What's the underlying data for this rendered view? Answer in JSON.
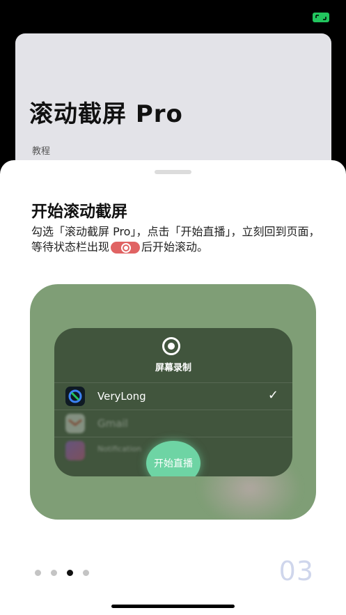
{
  "status": {
    "icon": "fullscreen-icon",
    "color": "#22c55e"
  },
  "background_card": {
    "title": "滚动截屏 Pro",
    "subtitle": "教程"
  },
  "sheet": {
    "title": "开始滚动截屏",
    "desc_part1": "勾选「滚动截屏 Pro」，点击「开始直播」，立刻回到页面，等待状态栏出现",
    "desc_part2": "后开始滚动。",
    "record_pill_color": "#e06363"
  },
  "illustration": {
    "panel_title": "屏幕录制",
    "apps": [
      {
        "name": "VeryLong",
        "checked": true,
        "icon": "verylong-app-icon"
      },
      {
        "name": "Gmail",
        "checked": false,
        "icon": "gmail-app-icon"
      },
      {
        "name": "Notification",
        "checked": false,
        "icon": "app-icon"
      }
    ],
    "start_button": "开始直播"
  },
  "pagination": {
    "total": 4,
    "current": 3,
    "page_label": "03"
  }
}
